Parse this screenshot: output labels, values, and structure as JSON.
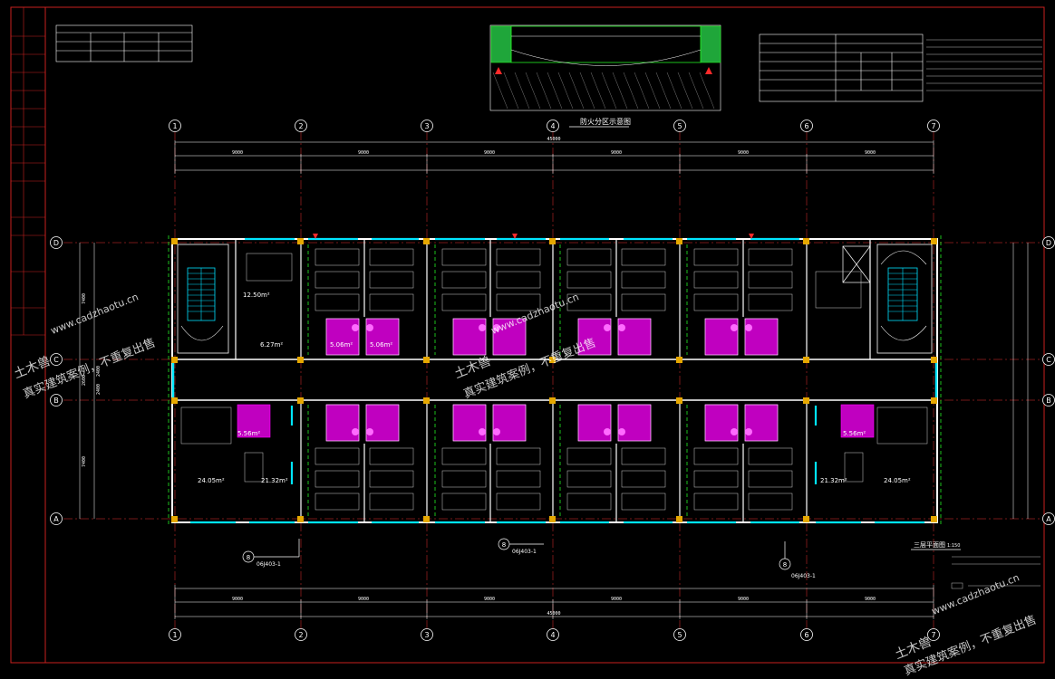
{
  "colors": {
    "background": "#000000",
    "frame": "#c8201e",
    "axis": "#e83030",
    "wall": "#ffffff",
    "window": "#00e5ff",
    "column": "#e6a800",
    "fixture": "#ff00ff",
    "stair": "#00e0ff",
    "green": "#22ee22",
    "dimension": "#ffffff"
  },
  "grid_top": {
    "axes": [
      "1",
      "2",
      "3",
      "4",
      "5",
      "6",
      "7"
    ],
    "overall_dim": "45000",
    "bay_dims": [
      "9000",
      "9000",
      "9000",
      "9000",
      "9000",
      "9000"
    ]
  },
  "grid_side": {
    "axes": [
      "D",
      "C",
      "B",
      "A"
    ],
    "dims": [
      "7400",
      "2400",
      "2600",
      "2400",
      "7400"
    ]
  },
  "titles": {
    "fire_zone": "防火分区示意图",
    "plan_name": "三层平面图",
    "plan_scale": "1:150"
  },
  "area_labels": {
    "a1": "12.50m²",
    "a2": "6.27m²",
    "a3": "5.06m²",
    "a4": "5.06m²",
    "a5": "5.56m²",
    "a6": "24.05m²",
    "a7": "21.32m²",
    "a8": "21.32m²",
    "a9": "24.05m²",
    "a10": "5.56m²"
  },
  "detail_refs": {
    "r1": "8",
    "r2": "8",
    "r3": "8",
    "r1_code": "06J403-1",
    "r2_code": "06J403-1",
    "r3_code": "06J403-1"
  },
  "watermark": {
    "site": "www.cadzhaotu.cn",
    "brand": "土木兽",
    "slogan": "真实建筑案例，不重复出售"
  }
}
